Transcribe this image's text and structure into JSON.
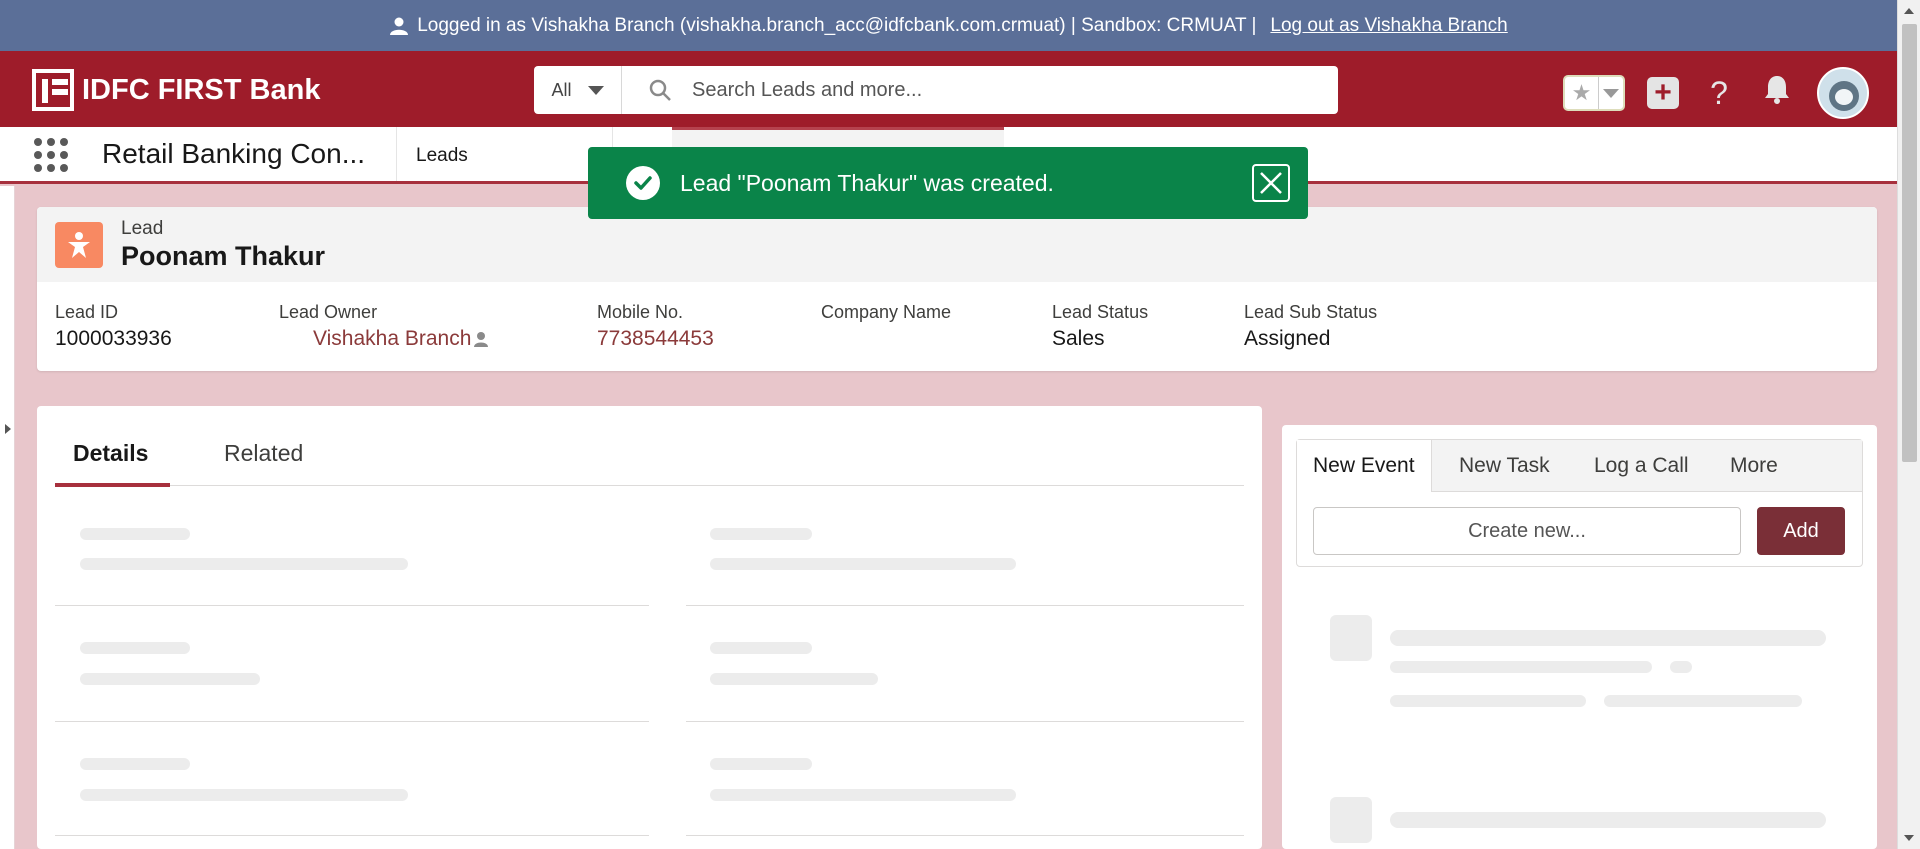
{
  "banner": {
    "text": "Logged in as Vishakha Branch (vishakha.branch_acc@idfcbank.com.crmuat) | Sandbox: CRMUAT |",
    "logout_link": "Log out as Vishakha Branch"
  },
  "header": {
    "logo_text": "IDFC FIRST Bank",
    "search_scope": "All",
    "search_placeholder": "Search Leads and more..."
  },
  "appnav": {
    "app_name": "Retail Banking Con...",
    "tab_leads": "Leads"
  },
  "toast": {
    "message": "Lead \"Poonam Thakur\" was created."
  },
  "record": {
    "object_type": "Lead",
    "name": "Poonam Thakur",
    "fields": [
      {
        "label": "Lead ID",
        "value": "1000033936"
      },
      {
        "label": "Lead Owner",
        "value": "Vishakha Branch"
      },
      {
        "label": "Mobile No.",
        "value": "7738544453"
      },
      {
        "label": "Company Name",
        "value": ""
      },
      {
        "label": "Lead Status",
        "value": "Sales"
      },
      {
        "label": "Lead Sub Status",
        "value": "Assigned"
      }
    ]
  },
  "details": {
    "tab_details": "Details",
    "tab_related": "Related"
  },
  "activity": {
    "tabs": [
      "New Event",
      "New Task",
      "Log a Call",
      "More"
    ],
    "create_placeholder": "Create new...",
    "add_label": "Add"
  }
}
